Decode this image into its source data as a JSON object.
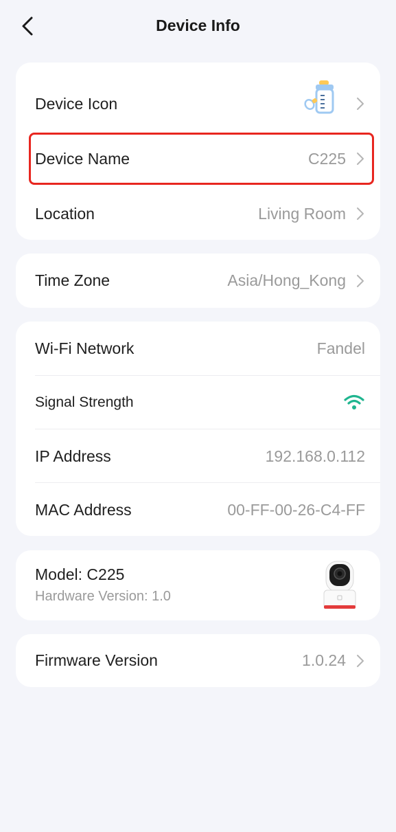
{
  "header": {
    "title": "Device Info"
  },
  "card1": {
    "device_icon": {
      "label": "Device Icon",
      "icon": "baby-bottle-icon"
    },
    "device_name": {
      "label": "Device Name",
      "value": "C225"
    },
    "location": {
      "label": "Location",
      "value": "Living Room"
    }
  },
  "card2": {
    "time_zone": {
      "label": "Time Zone",
      "value": "Asia/Hong_Kong"
    }
  },
  "card3": {
    "wifi": {
      "label": "Wi-Fi Network",
      "value": "Fandel"
    },
    "signal": {
      "label": "Signal Strength",
      "icon": "wifi-signal-icon",
      "color": "#1fb58f"
    },
    "ip": {
      "label": "IP Address",
      "value": "192.168.0.112"
    },
    "mac": {
      "label": "MAC Address",
      "value": "00-FF-00-26-C4-FF"
    }
  },
  "card4": {
    "model": "Model: C225",
    "hardware": "Hardware Version: 1.0"
  },
  "card5": {
    "firmware": {
      "label": "Firmware Version",
      "value": "1.0.24"
    }
  },
  "colors": {
    "highlight": "#e8261f",
    "accent": "#1fb58f",
    "background": "#f4f5fa"
  }
}
